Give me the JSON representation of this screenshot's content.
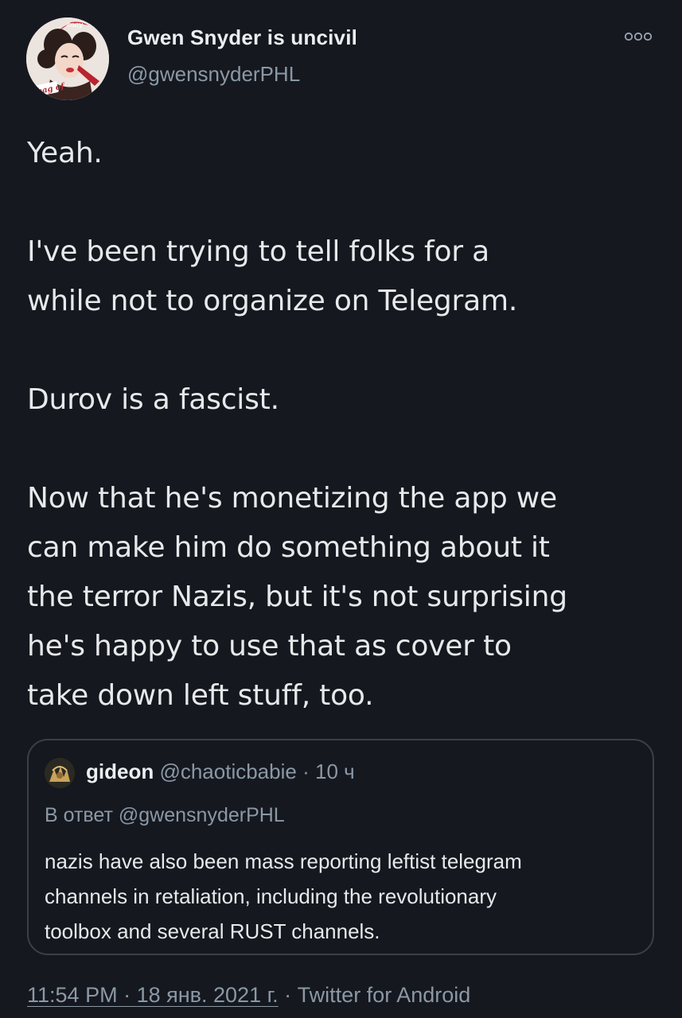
{
  "author": {
    "display_name": "Gwen Snyder is uncivil",
    "handle": "@gwensnyderPHL",
    "avatar_text": "a bag of"
  },
  "tweet": {
    "lines_1": [
      "Yeah."
    ],
    "lines_2": [
      "I've been trying to tell folks for a",
      "while not to organize on Telegram."
    ],
    "lines_3": [
      "Durov is a fascist."
    ],
    "lines_4": [
      "Now that he's monetizing the app we",
      "can make him do something about it",
      "the terror Nazis, but it's not surprising",
      "he's happy to use that as cover to",
      "take down left stuff, too."
    ]
  },
  "quote": {
    "name": "gideon",
    "handle": "@chaoticbabie",
    "separator": "·",
    "time": "10 ч",
    "reply_to": "В ответ @gwensnyderPHL",
    "lines": [
      "nazis have also been mass reporting leftist telegram",
      "channels in retaliation, including the revolutionary",
      "toolbox and several RUST channels."
    ]
  },
  "meta": {
    "time": "11:54 PM",
    "dot1": "·",
    "date": "18 янв. 2021 г.",
    "dot2": "·",
    "source": "Twitter for Android"
  },
  "icons": {
    "more": "more-options-icon"
  },
  "colors": {
    "background": "#15181f",
    "primary_text": "#e7e9ea",
    "secondary_text": "#8b98a5",
    "border": "#3a4048"
  }
}
